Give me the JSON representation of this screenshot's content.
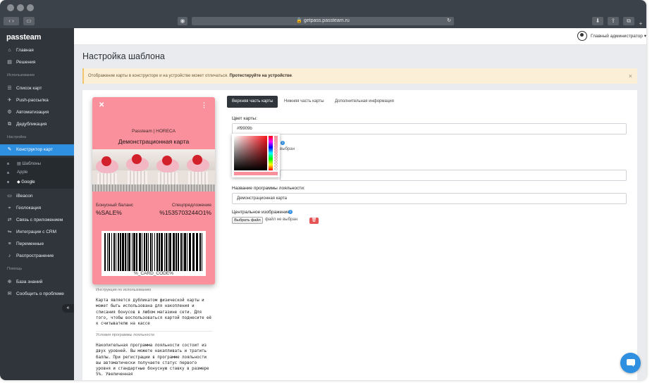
{
  "browser": {
    "url": "getpass.passteam.ru"
  },
  "sidebar": {
    "logo": "passteam",
    "items_main": [
      {
        "label": "Главная",
        "icon": "home-icon"
      },
      {
        "label": "Решения",
        "icon": "solutions-icon"
      }
    ],
    "section_usage": "Использование",
    "items_usage": [
      {
        "label": "Список карт",
        "icon": "list-icon"
      },
      {
        "label": "Push-рассылка",
        "icon": "push-icon"
      },
      {
        "label": "Автоматизация",
        "icon": "automation-icon"
      },
      {
        "label": "Дедубликация",
        "icon": "duplicate-icon"
      }
    ],
    "section_settings": "Настройка",
    "active_item": {
      "label": "Конструктор карт",
      "icon": "brush-icon"
    },
    "subitems": [
      "Шаблоны",
      "Apple",
      "Google"
    ],
    "items_settings": [
      {
        "label": "iBeacon",
        "icon": "beacon-icon"
      },
      {
        "label": "Геолокация",
        "icon": "location-icon"
      },
      {
        "label": "Связь с приложением",
        "icon": "link-icon"
      },
      {
        "label": "Интеграции с CRM",
        "icon": "crm-icon"
      },
      {
        "label": "Переменные",
        "icon": "variables-icon"
      },
      {
        "label": "Распространение",
        "icon": "bell-icon"
      }
    ],
    "section_help": "Помощь",
    "items_help": [
      {
        "label": "База знаний",
        "icon": "knowledge-icon"
      },
      {
        "label": "Сообщить о проблеме",
        "icon": "report-icon"
      }
    ]
  },
  "topbar": {
    "admin_name": "Главный администратор"
  },
  "page": {
    "title": "Настройка шаблона",
    "alert_text": "Отображение карты в конструкторе и на устройстве может отличаться.",
    "alert_link": "Протестируйте на устройстве",
    "alert_dot": "."
  },
  "pass": {
    "org": "Passteam | HORECA",
    "title": "Демонстрационная карта",
    "field_left_label": "Бонусный баланс",
    "field_left_value": "%SALE%",
    "field_right_label": "Спецпредложение",
    "field_right_value": "%1535703244О1%",
    "barcode_text": "%_CARD_CODE%",
    "color": "#f9909b"
  },
  "back": {
    "instr_label": "Инструкция по использованию",
    "instr_text": "Карта является дубликатом физической карты и может быть использована для накопления и списания бонусов в любом магазине сети. Для того, чтобы воспользоваться картой поднесите её к считывателю на кассе",
    "terms_label": "Условия программы лояльности",
    "terms_text": "Накопительная программа лояльности состоит из двух уровней. Вы можете накапливать и тратить баллы. При регистрации в программе лояльности вы автоматически получаете статус первого уровня и стандартные бонусную ставку в размере 5%. Увеличенная"
  },
  "settings": {
    "tabs": [
      "Верхняя часть карты",
      "Нижняя часть карты",
      "Дополнительная информация"
    ],
    "active_tab": 0,
    "color_label": "Цвет карты:",
    "color_value": "#f9909b",
    "hidden_file_text": "выбран",
    "loyalty_label": "Название программы лояльности:",
    "loyalty_value": "Демонстрационная карта",
    "central_label": "Центральное изображение:",
    "file_button": "Выбрать файл",
    "file_none": "файл не выбран"
  }
}
